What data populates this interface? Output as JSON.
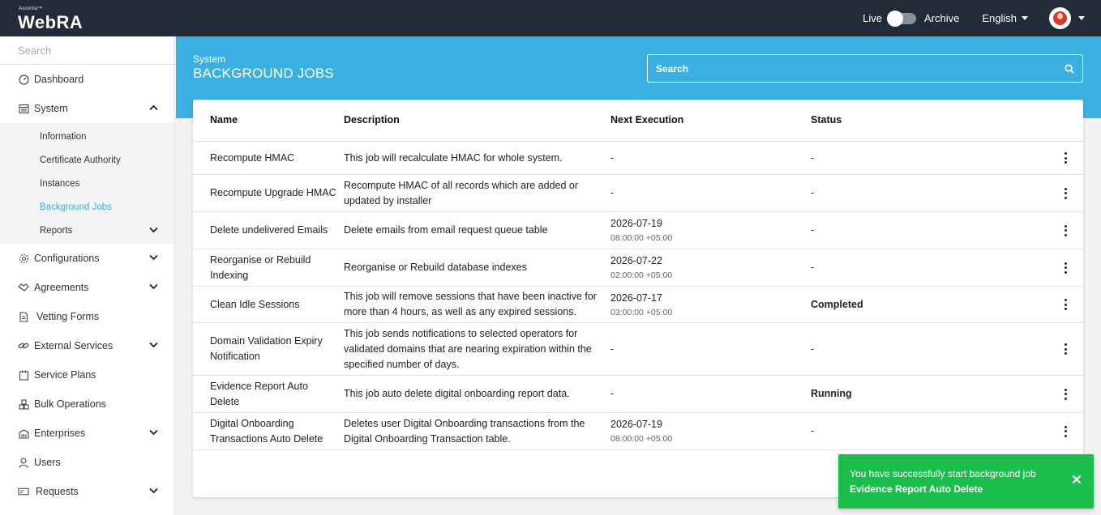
{
  "app": {
    "logo_small": "Ascertia™",
    "logo_main": "WebRA"
  },
  "topbar": {
    "live_label": "Live",
    "archive_label": "Archive",
    "language": "English"
  },
  "sidebar": {
    "search_placeholder": "Search",
    "items": [
      {
        "label": "Dashboard",
        "icon": "dashboard-icon"
      },
      {
        "label": "System",
        "icon": "system-icon",
        "expanded": true
      },
      {
        "label": "Configurations",
        "icon": "gear-icon"
      },
      {
        "label": "Agreements",
        "icon": "handshake-icon"
      },
      {
        "label": "Vetting Forms",
        "icon": "form-icon"
      },
      {
        "label": "External Services",
        "icon": "link-icon"
      },
      {
        "label": "Service Plans",
        "icon": "plans-icon"
      },
      {
        "label": "Bulk Operations",
        "icon": "boxes-icon"
      },
      {
        "label": "Enterprises",
        "icon": "building-icon"
      },
      {
        "label": "Users",
        "icon": "user-icon"
      },
      {
        "label": "Requests",
        "icon": "requests-icon"
      }
    ],
    "system_sub": [
      {
        "label": "Information"
      },
      {
        "label": "Certificate Authority"
      },
      {
        "label": "Instances"
      },
      {
        "label": "Background Jobs",
        "active": true
      },
      {
        "label": "Reports"
      }
    ]
  },
  "header": {
    "breadcrumb": "System",
    "title": "BACKGROUND JOBS",
    "search_placeholder": "Search"
  },
  "table": {
    "columns": [
      "Name",
      "Description",
      "Next Execution",
      "Status"
    ],
    "rows": [
      {
        "name": "Recompute HMAC",
        "description": "This job will recalculate HMAC for whole system.",
        "next_date": "-",
        "next_time": "",
        "status": "-"
      },
      {
        "name": "Recompute Upgrade HMAC",
        "description": "Recompute HMAC of all records which are added or updated by installer",
        "next_date": "-",
        "next_time": "",
        "status": "-"
      },
      {
        "name": "Delete undelivered Emails",
        "description": "Delete emails from email request queue table",
        "next_date": "2026-07-19",
        "next_time": "08:00:00 +05:00",
        "status": "-"
      },
      {
        "name": "Reorganise or Rebuild Indexing",
        "description": "Reorganise or Rebuild database indexes",
        "next_date": "2026-07-22",
        "next_time": "02:00:00 +05:00",
        "status": "-"
      },
      {
        "name": "Clean Idle Sessions",
        "description": "This job will remove sessions that have been inactive for more than 4 hours, as well as any expired sessions.",
        "next_date": "2026-07-17",
        "next_time": "03:00:00 +05:00",
        "status": "Completed"
      },
      {
        "name": "Domain Validation Expiry Notification",
        "description": "This job sends notifications to selected operators for validated domains that are nearing expiration within the specified number of days.",
        "next_date": "-",
        "next_time": "",
        "status": "-"
      },
      {
        "name": "Evidence Report Auto Delete",
        "description": "This job auto delete digital onboarding report data.",
        "next_date": "-",
        "next_time": "",
        "status": "Running"
      },
      {
        "name": "Digital Onboarding Transactions Auto Delete",
        "description": "Deletes user Digital Onboarding transactions from the Digital Onboarding Transaction table.",
        "next_date": "2026-07-19",
        "next_time": "08:00:00 +05:00",
        "status": "-"
      }
    ]
  },
  "toast": {
    "message": "You have successfully start background job",
    "job": "Evidence Report Auto Delete"
  },
  "colors": {
    "topbar": "#232a38",
    "accent": "#3ab0e2",
    "toast": "#1bbd4c"
  }
}
